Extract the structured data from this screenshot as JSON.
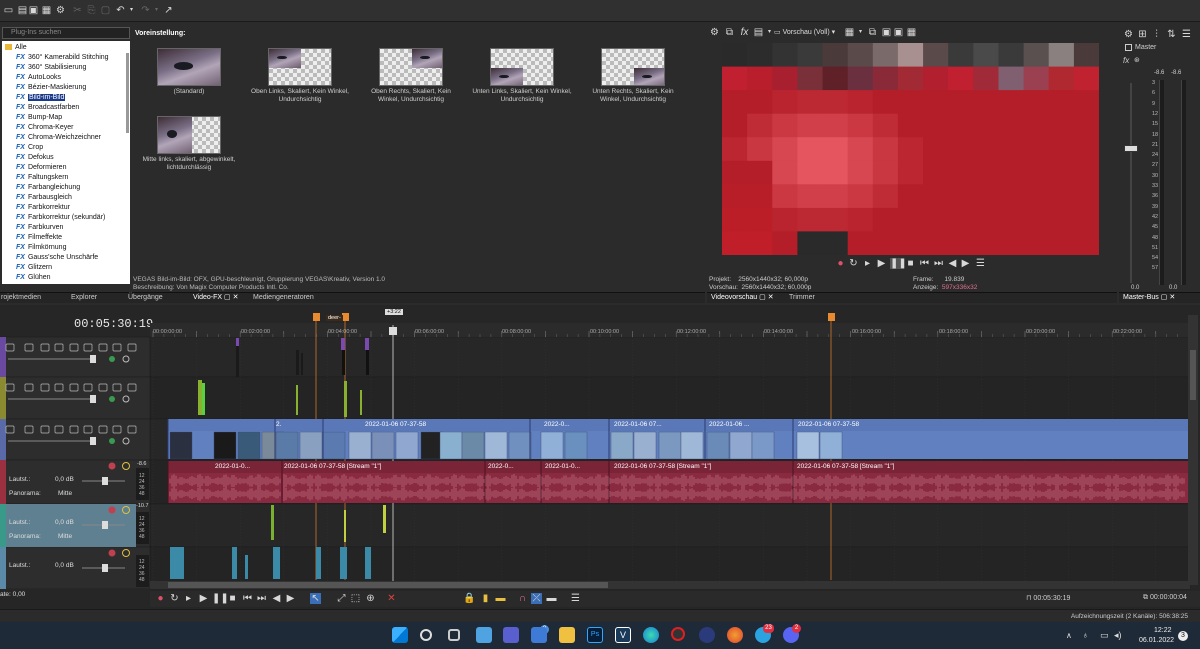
{
  "fx_panel": {
    "search_placeholder": "Plug-Ins suchen",
    "preset_label": "Voreinstellung:",
    "root_item": "Alle",
    "fx_tag": "FX",
    "effects": [
      "360° Kamerabild Stitching",
      "360° Stabilisierung",
      "AutoLooks",
      "Bézier-Maskierung",
      "Bild-im-Bild",
      "Broadcastfarben",
      "Bump-Map",
      "Chroma-Keyer",
      "Chroma-Weichzeichner",
      "Crop",
      "Defokus",
      "Deformieren",
      "Faltungskern",
      "Farbangleichung",
      "Farbausgleich",
      "Farbkorrektur",
      "Farbkorrektur (sekundär)",
      "Farbkurven",
      "Filmeffekte",
      "Filmkörnung",
      "Gauss'sche Unschärfe",
      "Glitzern",
      "Glühen"
    ],
    "selected_effect": "Bild-im-Bild",
    "presets": [
      {
        "caption": "(Standard)"
      },
      {
        "caption": "Oben Links, Skaliert, Kein Winkel, Undurchsichtig"
      },
      {
        "caption": "Oben Rechts, Skaliert, Kein Winkel, Undurchsichtig"
      },
      {
        "caption": "Unten Links, Skaliert, Kein Winkel, Undurchsichtig"
      },
      {
        "caption": "Unten Rechts, Skaliert, Kein Winkel, Undurchsichtig"
      },
      {
        "caption": "Mitte links, skaliert, abgewinkelt, lichtdurchlässig"
      }
    ],
    "info_line1": "VEGAS Bild-im-Bild: OFX, GPU-beschleunigt, Gruppierung VEGAS\\Kreativ, Version 1.0",
    "info_line2": "Beschreibung: Von Magix Computer Products Intl. Co."
  },
  "tabs_left": [
    "rojektmedien",
    "Explorer",
    "Übergänge",
    "Video-FX",
    "Mediengeneratoren"
  ],
  "tabs_right": [
    "Videovorschau",
    "Trimmer"
  ],
  "tab_master": "Master-Bus",
  "preview": {
    "mode": "Vorschau (Voll)",
    "projekt_label": "Projekt:",
    "projekt_value": "2560x1440x32; 60,000p",
    "vorschau_label": "Vorschau:",
    "vorschau_value": "2560x1440x32; 60,000p",
    "frame_label": "Frame:",
    "frame_value": "19.839",
    "anzeige_label": "Anzeige:",
    "anzeige_value": "597x336x32"
  },
  "master": {
    "label": "Master",
    "left_level": "-8.6",
    "right_level": "-8.6",
    "scale": [
      "3",
      "6",
      "9",
      "12",
      "15",
      "18",
      "21",
      "24",
      "27",
      "30",
      "33",
      "36",
      "39",
      "42",
      "45",
      "48",
      "51",
      "54",
      "57"
    ],
    "bottom_left": "0.0",
    "bottom_right": "0.0"
  },
  "timeline": {
    "current_time": "00:05:30:19",
    "marker_label": "+3:22",
    "ruler": [
      "00:00:00:00",
      "00:02:00:00",
      "00:04:00:00",
      "00:06:00:00",
      "00:08:00:00",
      "00:10:00:00",
      "00:12:00:00",
      "00:14:00:00",
      "00:16:00:00",
      "00:18:00:00",
      "00:20:00:00",
      "00:22:00:00"
    ],
    "region_label": "deer-",
    "audio_tracks": [
      {
        "vol_label": "Lautst.:",
        "vol": "0,0 dB",
        "pan_label": "Panorama:",
        "pan": "Mitte",
        "level": "-8.6"
      },
      {
        "vol_label": "Lautst.:",
        "vol": "0,0 dB",
        "pan_label": "Panorama:",
        "pan": "Mitte",
        "level": "-10.7"
      },
      {
        "vol_label": "Lautst.:",
        "vol": "0,0 dB"
      }
    ],
    "meter_ticks": [
      "12",
      "24",
      "36",
      "48"
    ],
    "video_clips": [
      "2.",
      "2022-01-06 07-37-58",
      "2022-0...",
      "2022-01-06 07...",
      "2022-01-06 ...",
      "2022-01-06 07-37-58"
    ],
    "audio_clips": [
      "2022-01-0...",
      "2022-01-06 07-37-58 [Stream \"1\"]",
      "2022-0...",
      "2022-01-0...",
      "2022-01-06 07-37-58 [Stream \"1\"]",
      "2022-01-06 07-37-58 [Stream \"1\"]"
    ],
    "rate_label": "ate: 0,00",
    "cursor_time": "00:05:30:19",
    "end_time": "00:00:00:04"
  },
  "status": {
    "record_time": "Aufzeichnungszeit (2 Kanäle): 506:38:25"
  },
  "taskbar": {
    "time": "12:22",
    "date": "06.01.2022",
    "notif_count": "3",
    "badge_teams": "8",
    "badge_telegram": "23",
    "badge_discord": "2"
  }
}
